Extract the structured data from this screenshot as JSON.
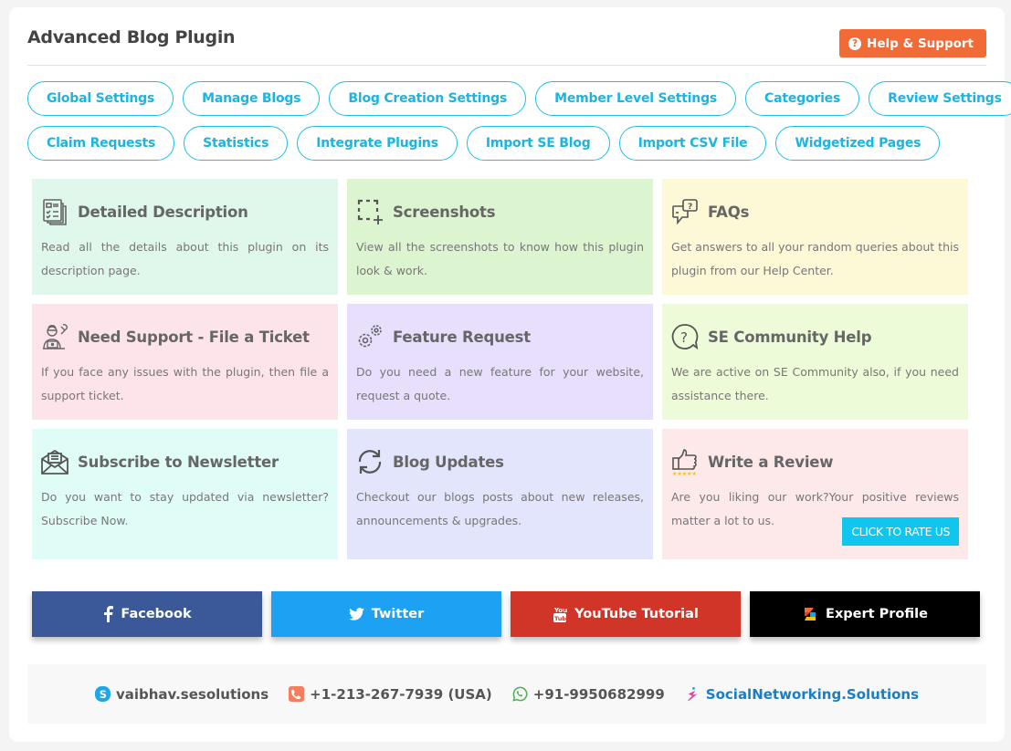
{
  "header": {
    "title": "Advanced Blog Plugin",
    "help_button": "Help & Support"
  },
  "nav": {
    "row1": [
      "Global Settings",
      "Manage Blogs",
      "Blog Creation Settings",
      "Member Level Settings",
      "Categories",
      "Review Settings"
    ],
    "row2": [
      "Claim Requests",
      "Statistics",
      "Integrate Plugins",
      "Import SE Blog",
      "Import CSV File",
      "Widgetized Pages"
    ]
  },
  "cards": [
    {
      "title": "Detailed Description",
      "desc": "Read all the details about this plugin on its description page.",
      "icon": "document-list-icon",
      "bg": "#e0f7ec"
    },
    {
      "title": "Screenshots",
      "desc": "View all the screenshots to know how this plugin look & work.",
      "icon": "screenshot-select-icon",
      "bg": "#dcf5d0"
    },
    {
      "title": "FAQs",
      "desc": "Get answers to all your random queries about this plugin from our Help Center.",
      "icon": "chat-question-icon",
      "bg": "#fdf8d6"
    },
    {
      "title": "Need Support - File a Ticket",
      "desc": "If you face any issues with the plugin, then file a support ticket.",
      "icon": "support-person-icon",
      "bg": "#fde3ea"
    },
    {
      "title": "Feature Request",
      "desc": "Do you need a new feature for your website, request a quote.",
      "icon": "gears-icon",
      "bg": "#e8dffd"
    },
    {
      "title": "SE Community Help",
      "desc": "We are active on SE Community also, if you need assistance there.",
      "icon": "question-bubble-icon",
      "bg": "#eefbd8"
    },
    {
      "title": "Subscribe to Newsletter",
      "desc": "Do you want to stay updated via newsletter? Subscribe Now.",
      "icon": "envelope-open-icon",
      "bg": "#e0fcf6"
    },
    {
      "title": "Blog Updates",
      "desc": "Checkout our blogs posts about new releases, announcements & upgrades.",
      "icon": "refresh-icon",
      "bg": "#e2e5fc"
    },
    {
      "title": "Write a Review",
      "desc": "Are you liking our work?Your positive reviews matter a lot to us.",
      "icon": "thumbs-up-stars-icon",
      "bg": "#fde8ea",
      "button": "CLICK TO RATE US"
    }
  ],
  "social": [
    {
      "label": "Facebook",
      "color": "#3b5998",
      "icon": "facebook-icon"
    },
    {
      "label": "Twitter",
      "color": "#1da1f2",
      "icon": "twitter-icon"
    },
    {
      "label": "YouTube Tutorial",
      "color": "#d13528",
      "icon": "youtube-icon"
    },
    {
      "label": "Expert Profile",
      "color": "#000000",
      "icon": "expert-logo-icon"
    }
  ],
  "contacts": {
    "skype": "vaibhav.sesolutions",
    "phone": "+1-213-267-7939 (USA)",
    "whatsapp": "+91-9950682999",
    "website": "SocialNetworking.Solutions"
  },
  "colors": {
    "accent": "#1cb4e0",
    "help": "#f26b36",
    "rate": "#10c5ee"
  }
}
